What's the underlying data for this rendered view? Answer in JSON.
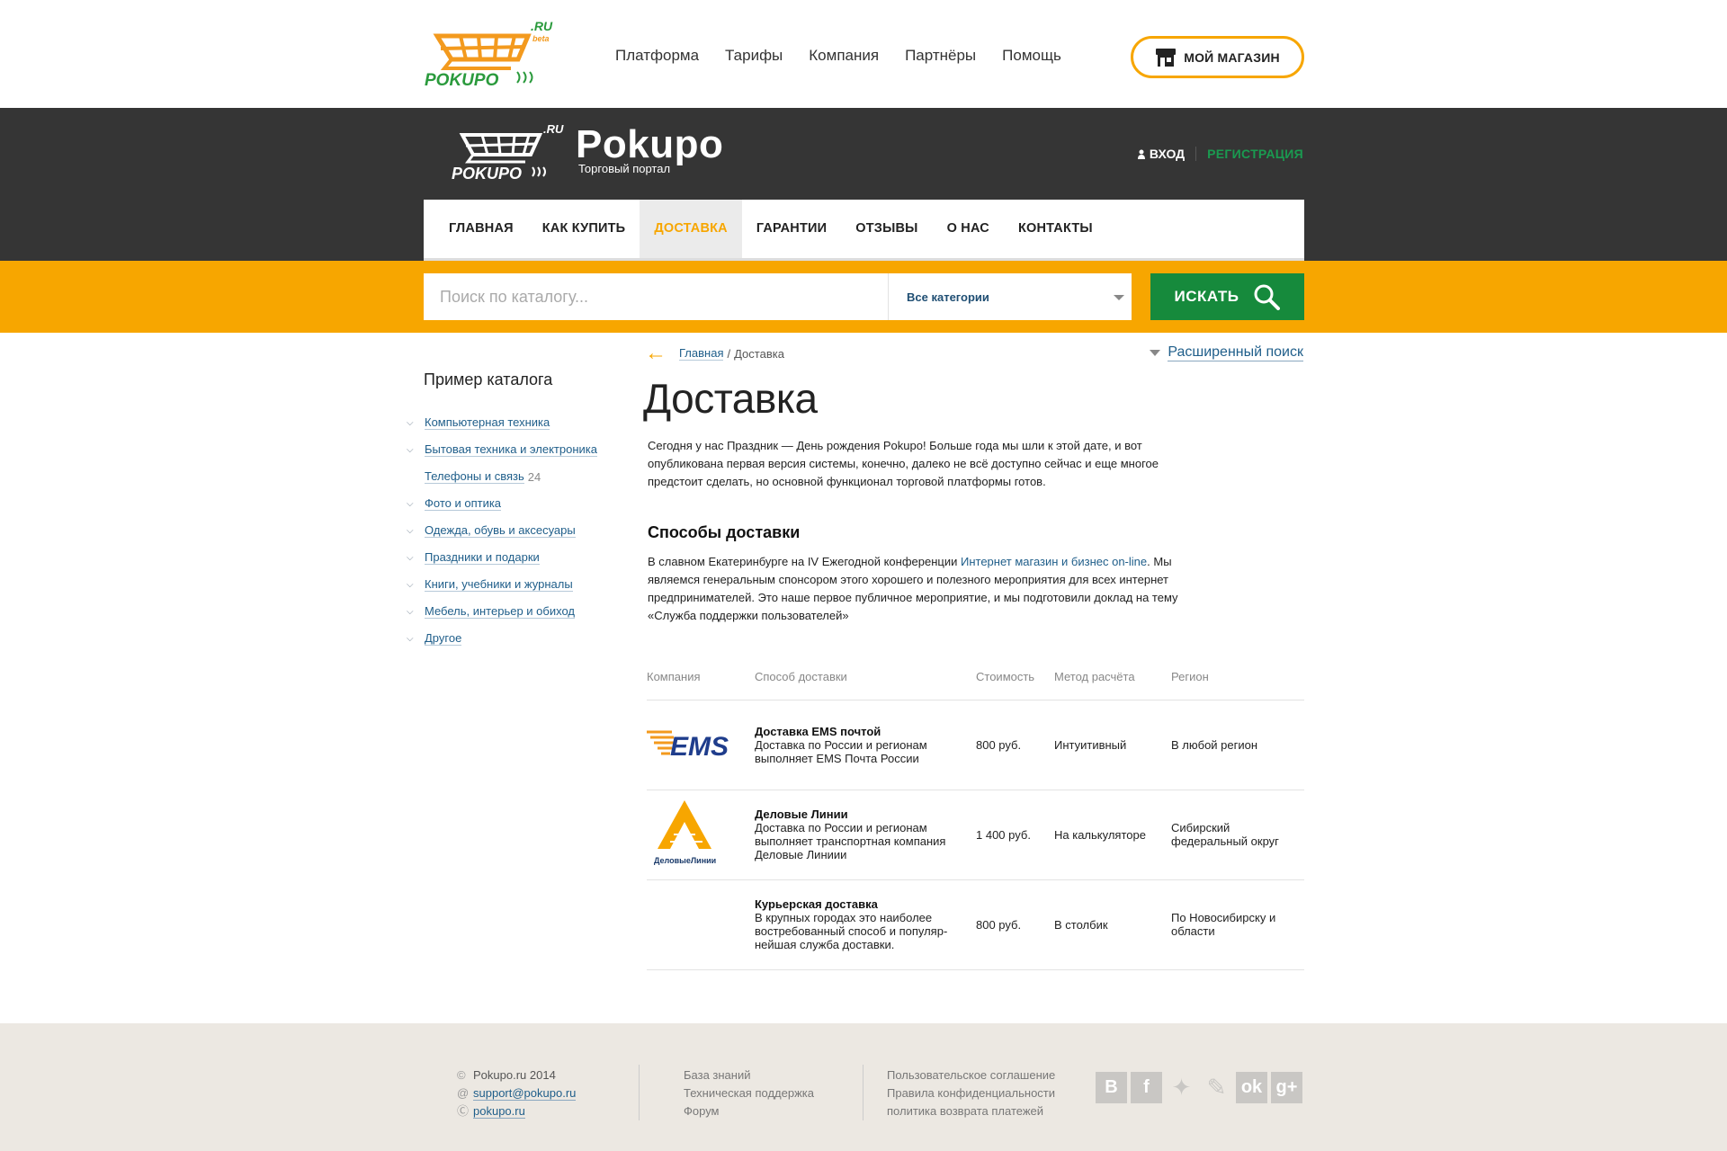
{
  "top_nav": [
    "Платформа",
    "Тарифы",
    "Компания",
    "Партнёры",
    "Помощь"
  ],
  "my_shop_label": "МОЙ МАГАЗИН",
  "logo_top": {
    "text": "POKUPO",
    "ru": ".RU",
    "beta": "beta"
  },
  "brand": {
    "title": "Pokupo",
    "subtitle": "Торговый портал",
    "logo_text": "POKUPO",
    "logo_ru": ".RU"
  },
  "auth": {
    "login": "ВХОД",
    "register": "РЕГИСТРАЦИЯ"
  },
  "main_nav": [
    "ГЛАВНАЯ",
    "КАК КУПИТЬ",
    "ДОСТАВКА",
    "ГАРАНТИИ",
    "ОТЗЫВЫ",
    "О НАС",
    "КОНТАКТЫ"
  ],
  "main_nav_active": "ДОСТАВКА",
  "search": {
    "placeholder": "Поиск по каталогу...",
    "category": "Все категории",
    "button": "ИСКАТЬ"
  },
  "sidebar": {
    "title": "Пример каталога",
    "items": [
      {
        "label": "Компьютерная техника",
        "chevron": true,
        "count": ""
      },
      {
        "label": "Бытовая техника и электроника",
        "chevron": true,
        "count": ""
      },
      {
        "label": "Телефоны и связь",
        "chevron": false,
        "count": "24"
      },
      {
        "label": "Фото и оптика",
        "chevron": true,
        "count": ""
      },
      {
        "label": "Одежда, обувь и аксесуары",
        "chevron": true,
        "count": ""
      },
      {
        "label": "Праздники и подарки",
        "chevron": true,
        "count": ""
      },
      {
        "label": "Книги, учебники и журналы",
        "chevron": true,
        "count": ""
      },
      {
        "label": "Мебель, интерьер и обиход",
        "chevron": true,
        "count": ""
      },
      {
        "label": "Другое",
        "chevron": true,
        "count": ""
      }
    ]
  },
  "breadcrumb": {
    "home": "Главная",
    "separator": "/",
    "current": "Доставка"
  },
  "advanced_search": "Расширенный поиск",
  "page_title": "Доставка",
  "intro": "Сегодня у нас Праздник — День рождения Pokupo! Больше года мы шли к этой дате, и вот опубликована первая версия системы, конечно, далеко не всё доступно сейчас и еще многое предстоит сделать, но основной функционал торговой платформы готов.",
  "section_title": "Способы доставки",
  "para2": {
    "before": "В славном Екатеринбурге на IV Ежегодной конференции ",
    "link": "Интернет магазин и бизнес on-line",
    "after": ". Мы являемся генеральным спонсором этого хорошего и полезного мероприятия для всех интернет предпринимателей. Это наше первое публичное мероприятие, и мы подготовили доклад на тему «Служба поддержки пользователей»"
  },
  "table": {
    "headers": [
      "Компания",
      "Способ доставки",
      "Стоимость",
      "Метод расчёта",
      "Регион"
    ],
    "rows": [
      {
        "logo": "ems-logo",
        "logo_text": "EMS",
        "method_title": "Доставка EMS почтой",
        "method_desc": "Доставка по России и регионам выполняет EMS Почта России",
        "cost": "800 руб.",
        "calc": "Интуитивный",
        "region": "В любой регион"
      },
      {
        "logo": "dellin-logo",
        "logo_text": "ДеловыеЛинии",
        "method_title": "Деловые Линии",
        "method_desc": "Доставка по России и регионам выполняет транспортная компания Деловые Линиии",
        "cost": "1 400 руб.",
        "calc": "На калькуляторе",
        "region": "Сибирский федеральный округ"
      },
      {
        "logo": "",
        "logo_text": "",
        "method_title": "Курьерская доставка",
        "method_desc": "В крупных городах это наиболее востребованный способ и популяр-нейшая  служба доставки.",
        "cost": "800 руб.",
        "calc": "В столбик",
        "region": "По Новосибирску и области"
      }
    ]
  },
  "footer": {
    "copyright": "Pokupo.ru 2014",
    "email": "support@pokupo.ru",
    "skype": "pokupo.ru",
    "links2": [
      "База знаний",
      "Техническая поддержка",
      "Форум"
    ],
    "links3": [
      "Пользовательское соглашение",
      "Правила конфиденциальности",
      "политика возврата платежей"
    ],
    "social_icons": [
      "vk-icon",
      "facebook-icon",
      "twitter-icon",
      "livejournal-icon",
      "odnoklassniki-icon",
      "googleplus-icon"
    ]
  },
  "colors": {
    "accent": "#f7a600",
    "green": "#168a3c",
    "link": "#1f5e8a",
    "dark": "#353535"
  }
}
